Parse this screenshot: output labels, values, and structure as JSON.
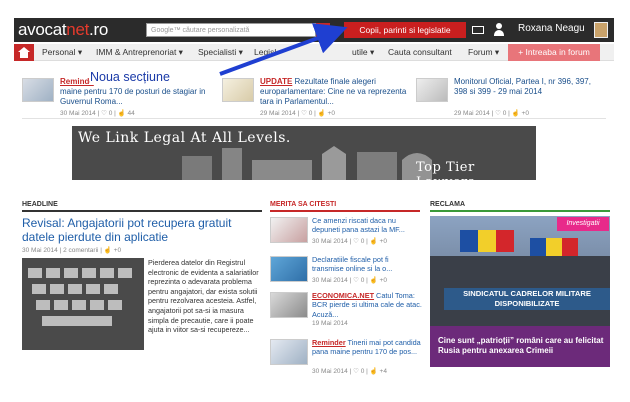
{
  "header": {
    "logo_left": "avocat",
    "logo_accent": "net",
    "logo_tld": ".ro",
    "search_placeholder": "Google™ căutare personalizată",
    "highlight_button": "Copii, parinti si legislatie",
    "username": "Roxana Neagu"
  },
  "nav": {
    "items": [
      "Personal ▾",
      "IMM & Antreprenoriat ▾",
      "Specialisti ▾",
      "Legisl",
      "utile ▾",
      "Cauta consultant",
      "Forum ▾"
    ],
    "cta": "+ Intreaba in forum"
  },
  "annotation": "Noua secțiune",
  "news": [
    {
      "tag": "Reminde",
      "text": "maine pentru 170 de posturi de stagiar in Guvernul Roma...",
      "meta": "30 Mai 2014 | ♡ 0 | ☝ 44"
    },
    {
      "tag": "UPDATE",
      "text": "Rezultate finale alegeri europarlamentare: Cine ne va reprezenta tara in Parlamentul...",
      "meta": "29 Mai 2014 | ♡ 0 | ☝ +0"
    },
    {
      "tag": "",
      "text": "Monitorul Oficial, Partea I, nr 396, 397, 398 si 399 - 29 mai 2014",
      "meta": "29 Mai 2014 | ♡ 0 | ☝ +0"
    }
  ],
  "banner": {
    "left": "We Link Legal At All Levels.",
    "right": "Top Tier Lawyers"
  },
  "headline": {
    "section": "HEADLINE",
    "title": "Revisal: Angajatorii pot recupera gratuit datele pierdute din aplicatie",
    "meta": "30 Mai 2014 | 2 comentarii | ☝ +0",
    "text": "Pierderea datelor din Registrul electronic de evidenta a salariatilor reprezinta o adevarata problema pentru angajatori, dar exista solutii pentru rezolvarea acesteia. Astfel, angajatorii pot sa-si ia masura simpla de precautie, care ii poate ajuta in viitor sa-si recupereze..."
  },
  "merita": {
    "section": "MERITA SA CITESTI",
    "items": [
      {
        "tag": "",
        "text": "Ce amenzi riscati daca nu depuneti pana astazi la MF...",
        "meta": "30 Mai 2014 | ♡ 0 | ☝ +0"
      },
      {
        "tag": "",
        "text": "Declaratiile fiscale pot fi transmise online si la o...",
        "meta": "30 Mai 2014 | ♡ 0 | ☝ +0"
      },
      {
        "tag": "ECONOMICA.NET",
        "text": " Catul Toma: BCR pierde si ultima cale de atac. Acuză...",
        "meta": "19 Mai 2014"
      },
      {
        "tag": "Reminder",
        "text": " Tinerii mai pot candida pana maine pentru 170 de pos...",
        "meta": "30 Mai 2014 | ♡ 0 | ☝ +4"
      }
    ]
  },
  "reclama": {
    "section": "RECLAMA",
    "tag": "Investigatii",
    "banner": "SINDICATUL CADRELOR MILITARE DISPONIBILIZATE",
    "caption": "Cine sunt „patrioții” români care au felicitat Rusia pentru anexarea Crimeii"
  },
  "colors": {
    "brand_red": "#c62828",
    "link_blue": "#1f5ea8",
    "ad_purple": "#6c2a7a"
  }
}
